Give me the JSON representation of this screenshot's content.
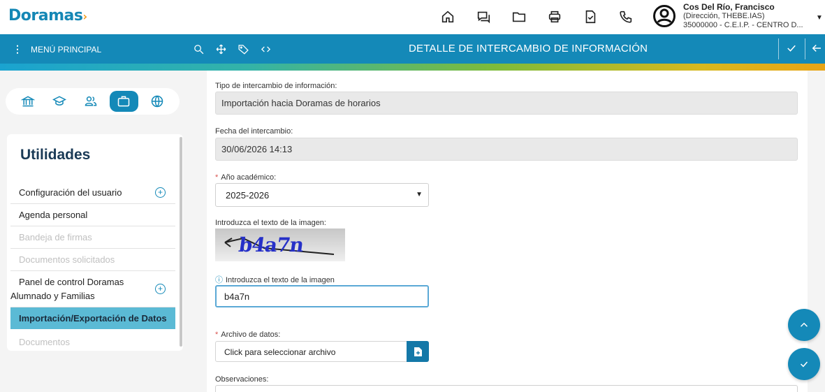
{
  "app": {
    "logo_text": "Doramas",
    "logo_arrow": "›"
  },
  "user": {
    "name": "Cos Del Río, Francisco",
    "role": "(Dirección, THEBE.IAS)",
    "center": "35000000 - C.E.I.P. - CENTRO D..."
  },
  "navbar": {
    "menu_dots": "⋮",
    "menu_label": "MENÚ PRINCIPAL",
    "title": "DETALLE DE INTERCAMBIO DE INFORMACIÓN"
  },
  "sidebar": {
    "heading": "Utilidades",
    "items": [
      {
        "label": "Configuración del usuario",
        "state": "normal",
        "expandable": true
      },
      {
        "label": "Agenda personal",
        "state": "normal",
        "expandable": false
      },
      {
        "label": "Bandeja de firmas",
        "state": "disabled",
        "expandable": false
      },
      {
        "label": "Documentos solicitados",
        "state": "disabled",
        "expandable": false
      },
      {
        "label": "Panel de control Doramas",
        "label_line2": "Alumnado y Familias",
        "state": "normal",
        "expandable": true
      },
      {
        "label": "Importación/Exportación de Datos",
        "state": "active",
        "expandable": false
      },
      {
        "label": "Documentos",
        "state": "disabled",
        "expandable": false
      }
    ],
    "plus_symbol": "+"
  },
  "form": {
    "tipo_label": "Tipo de intercambio de información:",
    "tipo_value": "Importación hacia Doramas de horarios",
    "fecha_label": "Fecha del intercambio:",
    "fecha_value": "30/06/2026 14:13",
    "required_mark": "*",
    "anio_label": "Año académico:",
    "anio_value": "2025-2026",
    "captcha_label": "Introduzca el texto de la imagen:",
    "captcha_image_text": "b4a7n",
    "info_mark": "ⓘ",
    "captcha_input_label": "Introduzca el texto de la imagen",
    "captcha_input_value": "b4a7n",
    "archivo_label": "Archivo de datos:",
    "archivo_placeholder": "Click para seleccionar archivo",
    "obs_label": "Observaciones:"
  },
  "colors": {
    "primary": "#1489b8",
    "active_item": "#5bbad5",
    "required": "#d9534f"
  },
  "icons": {
    "top": [
      "home-icon",
      "chat-icon",
      "folder-icon",
      "print-icon",
      "document-check-icon",
      "phone-icon",
      "user-circle-icon"
    ],
    "nav": [
      "search-icon",
      "move-icon",
      "tag-icon",
      "code-icon",
      "check-icon",
      "back-arrow-icon"
    ],
    "tabs": [
      "institution-icon",
      "graduation-cap-icon",
      "users-icon",
      "briefcase-icon",
      "globe-icon"
    ]
  }
}
